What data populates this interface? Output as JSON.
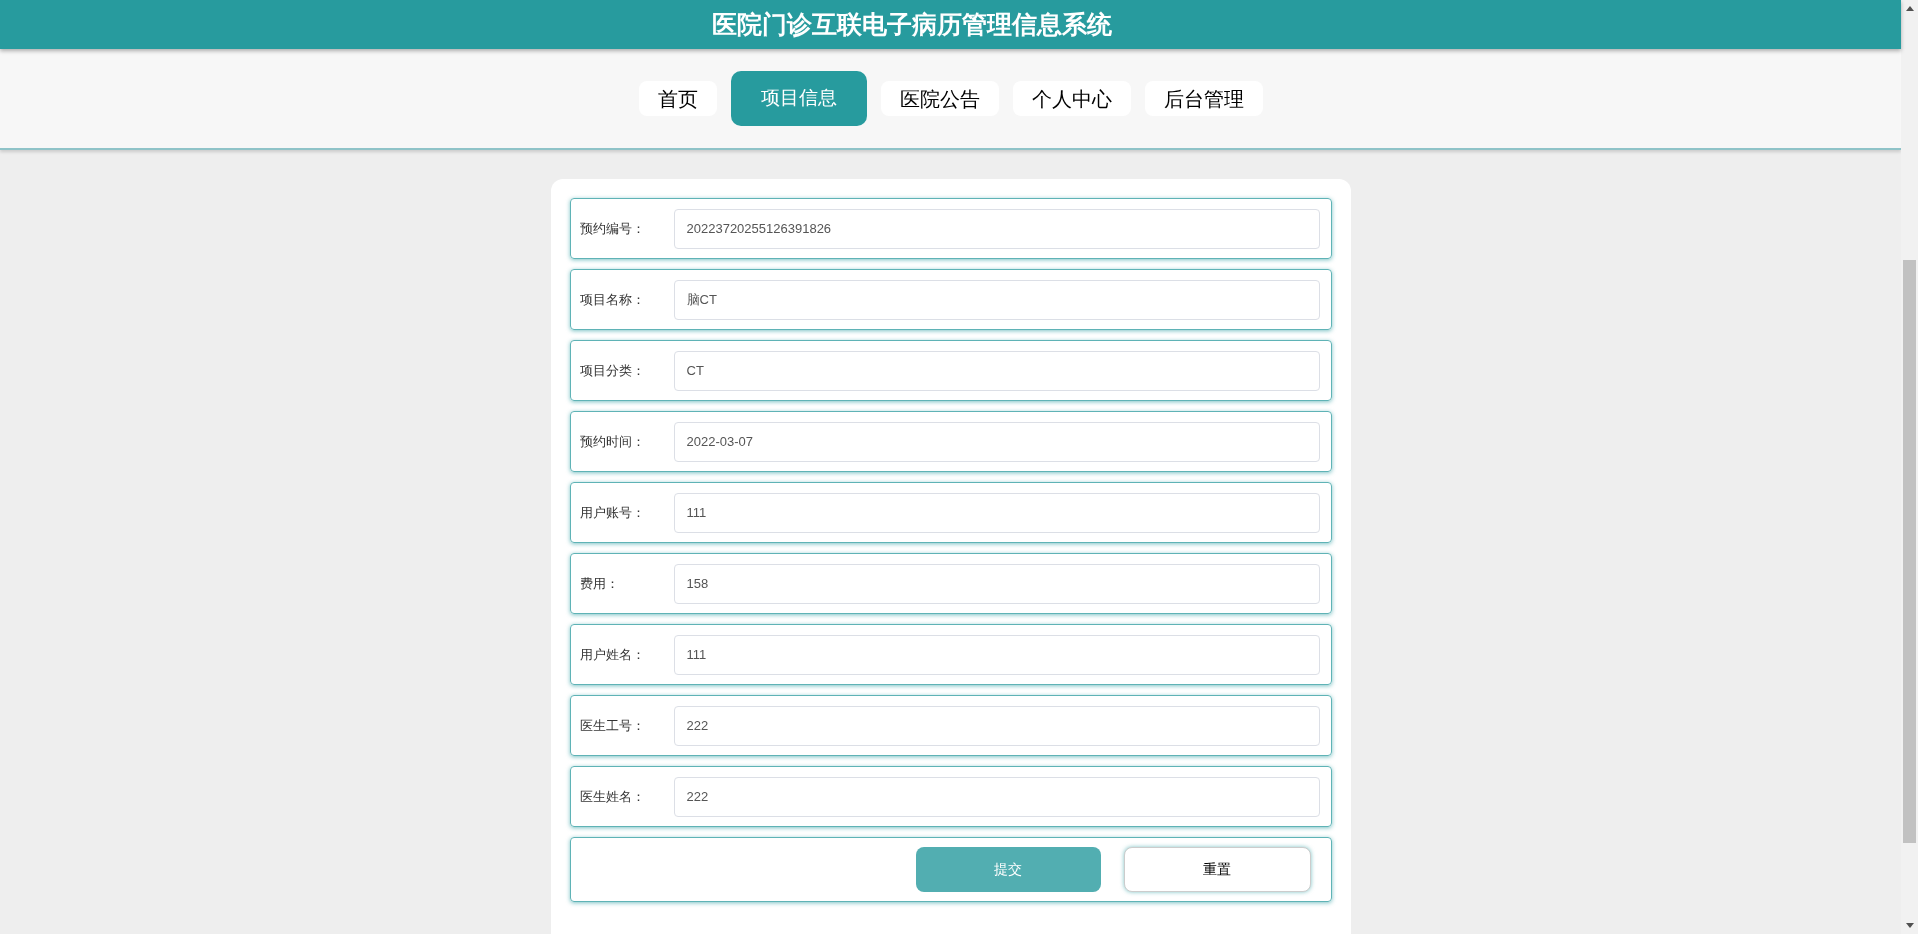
{
  "header": {
    "title": "医院门诊互联电子病历管理信息系统"
  },
  "nav": [
    {
      "label": "首页",
      "selected": false
    },
    {
      "label": "项目信息",
      "selected": true
    },
    {
      "label": "医院公告",
      "selected": false
    },
    {
      "label": "个人中心",
      "selected": false
    },
    {
      "label": "后台管理",
      "selected": false
    }
  ],
  "form": {
    "fields": [
      {
        "label": "预约编号：",
        "value": "20223720255126391826"
      },
      {
        "label": "项目名称：",
        "value": "脑CT"
      },
      {
        "label": "项目分类：",
        "value": "CT"
      },
      {
        "label": "预约时间：",
        "value": "2022-03-07"
      },
      {
        "label": "用户账号：",
        "value": "111"
      },
      {
        "label": "费用：",
        "value": "158"
      },
      {
        "label": "用户姓名：",
        "value": "111"
      },
      {
        "label": "医生工号：",
        "value": "222"
      },
      {
        "label": "医生姓名：",
        "value": "222"
      }
    ],
    "buttons": [
      {
        "label": "提交",
        "kind": "primary"
      },
      {
        "label": "重置",
        "kind": "secondary"
      }
    ]
  }
}
